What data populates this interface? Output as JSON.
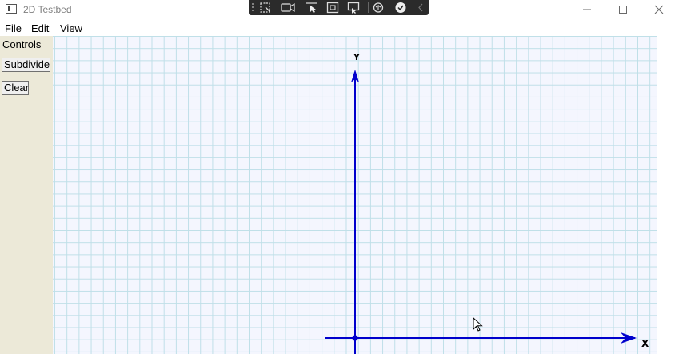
{
  "window": {
    "title": "2D Testbed",
    "icon": "app-window-icon"
  },
  "capture_toolbar": {
    "tools": [
      {
        "icon": "region-capture-icon"
      },
      {
        "icon": "video-camera-icon"
      },
      {
        "icon": "cursor-select-icon"
      },
      {
        "icon": "rectangle-capture-icon"
      },
      {
        "icon": "window-capture-icon"
      },
      {
        "icon": "auto-capture-icon"
      },
      {
        "icon": "confirm-check-icon"
      },
      {
        "icon": "collapse-arrow-icon"
      }
    ]
  },
  "window_controls": {
    "minimize": "minimize-icon",
    "maximize": "maximize-icon",
    "close": "close-icon"
  },
  "menu": {
    "file": "File",
    "edit": "Edit",
    "view": "View"
  },
  "panel": {
    "title": "Controls",
    "subdivide_label": "Subdivide",
    "clear_label": "Clear"
  },
  "canvas": {
    "y_axis_label": "Y",
    "x_axis_label": "X",
    "grid_color": "#bfdfe8",
    "background_color": "#f4f6fe",
    "axis_color": "#0000cc"
  }
}
